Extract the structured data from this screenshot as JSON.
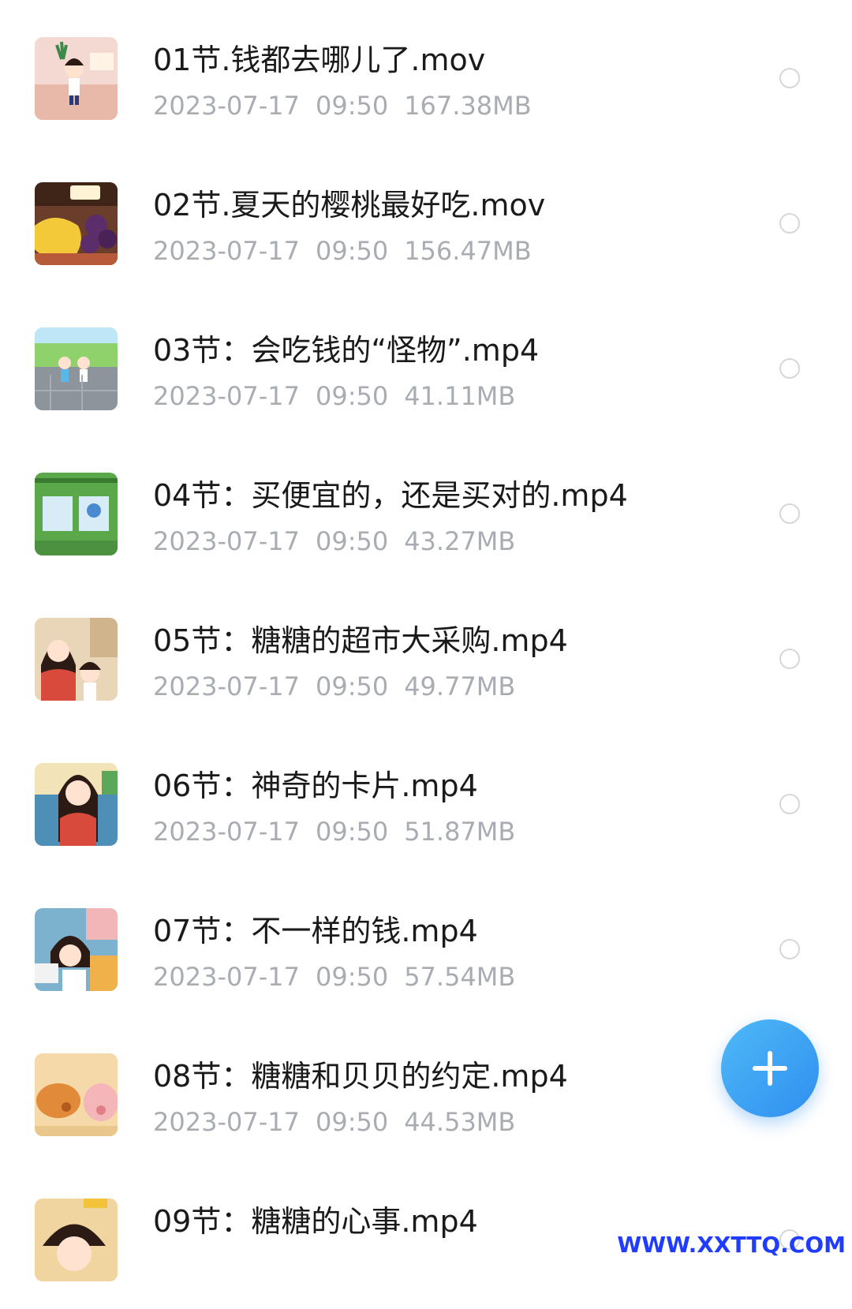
{
  "files": [
    {
      "title": "01节.钱都去哪儿了.mov",
      "date": "2023-07-17",
      "time": "09:50",
      "size": "167.38MB",
      "thumb_bg": "#f3d9d2"
    },
    {
      "title": "02节.夏天的樱桃最好吃.mov",
      "date": "2023-07-17",
      "time": "09:50",
      "size": "156.47MB",
      "thumb_bg": "#6b3d2b"
    },
    {
      "title": "03节：会吃钱的“怪物”.mp4",
      "date": "2023-07-17",
      "time": "09:50",
      "size": "41.11MB",
      "thumb_bg": "#8fd16b"
    },
    {
      "title": "04节：买便宜的，还是买对的.mp4",
      "date": "2023-07-17",
      "time": "09:50",
      "size": "43.27MB",
      "thumb_bg": "#5aa84a"
    },
    {
      "title": "05节：糖糖的超市大采购.mp4",
      "date": "2023-07-17",
      "time": "09:50",
      "size": "49.77MB",
      "thumb_bg": "#e9d6b8"
    },
    {
      "title": "06节：神奇的卡片.mp4",
      "date": "2023-07-17",
      "time": "09:50",
      "size": "51.87MB",
      "thumb_bg": "#4e8fb8"
    },
    {
      "title": "07节：不一样的钱.mp4",
      "date": "2023-07-17",
      "time": "09:50",
      "size": "57.54MB",
      "thumb_bg": "#7db2cf"
    },
    {
      "title": "08节：糖糖和贝贝的约定.mp4",
      "date": "2023-07-17",
      "time": "09:50",
      "size": "44.53MB",
      "thumb_bg": "#f6d9a8"
    },
    {
      "title": "09节：糖糖的心事.mp4",
      "date": "",
      "time": "",
      "size": "",
      "thumb_bg": "#f1d5a0"
    }
  ],
  "fab_icon": "plus-icon",
  "watermark": "WWW.XXTTQ.COM",
  "colors": {
    "fab": "#2f8ff0",
    "meta_text": "#a9adb3",
    "title_text": "#1a1a1a",
    "watermark": "#1f3cff"
  }
}
